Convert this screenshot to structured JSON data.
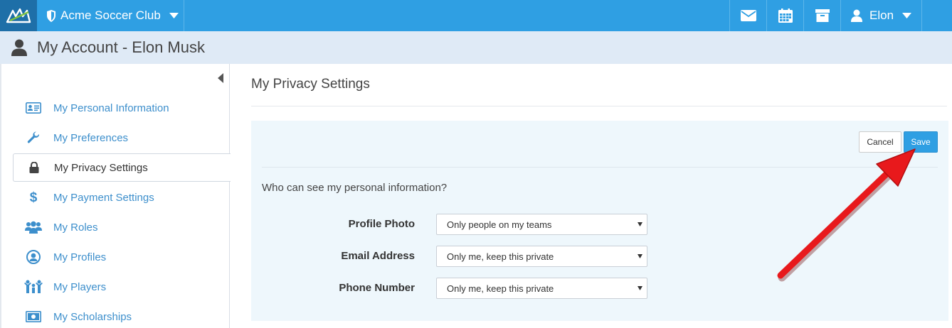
{
  "topbar": {
    "club_name": "Acme Soccer Club",
    "user_name": "Elon",
    "icons": [
      "mail-icon",
      "calendar-icon",
      "archive-icon",
      "user-icon"
    ],
    "bg_color": "#2f9fe3"
  },
  "account": {
    "title": "My Account - Elon Musk"
  },
  "sidebar": {
    "items": [
      {
        "label": "My Personal Information",
        "icon": "id-card-icon"
      },
      {
        "label": "My Preferences",
        "icon": "wrench-icon"
      },
      {
        "label": "My Privacy Settings",
        "icon": "lock-icon",
        "active": true
      },
      {
        "label": "My Payment Settings",
        "icon": "dollar-icon"
      },
      {
        "label": "My Roles",
        "icon": "users-icon"
      },
      {
        "label": "My Profiles",
        "icon": "user-circle-icon"
      },
      {
        "label": "My Players",
        "icon": "players-icon"
      },
      {
        "label": "My Scholarships",
        "icon": "money-icon"
      }
    ]
  },
  "main": {
    "title": "My Privacy Settings",
    "cancel_label": "Cancel",
    "save_label": "Save",
    "question": "Who can see my personal information?",
    "fields": [
      {
        "label": "Profile Photo",
        "value": "Only people on my teams"
      },
      {
        "label": "Email Address",
        "value": "Only me, keep this private"
      },
      {
        "label": "Phone Number",
        "value": "Only me, keep this private"
      }
    ]
  },
  "annotation": {
    "color": "#e8191c",
    "target": "save-button"
  }
}
